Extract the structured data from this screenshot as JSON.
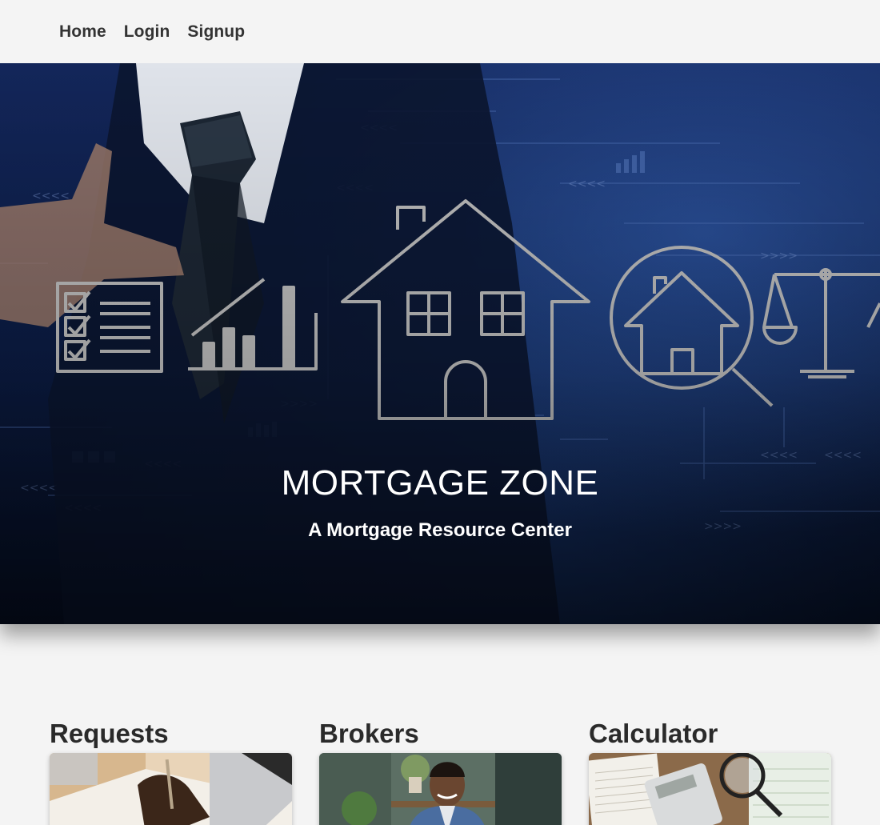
{
  "nav": {
    "items": [
      {
        "label": "Home"
      },
      {
        "label": "Login"
      },
      {
        "label": "Signup"
      }
    ]
  },
  "hero": {
    "title": "MORTGAGE ZONE",
    "subtitle": "A Mortgage Resource Center"
  },
  "cards": [
    {
      "title": "Requests",
      "image": "signing-document-photo"
    },
    {
      "title": "Brokers",
      "image": "smiling-broker-photo"
    },
    {
      "title": "Calculator",
      "image": "calculator-and-magnifier-photo"
    }
  ],
  "colors": {
    "page_bg": "#f4f4f4",
    "hero_dark": "#061027",
    "hero_blue": "#13265a",
    "line_art": "#b9b9b9",
    "text_dark": "#2a2a2a"
  }
}
